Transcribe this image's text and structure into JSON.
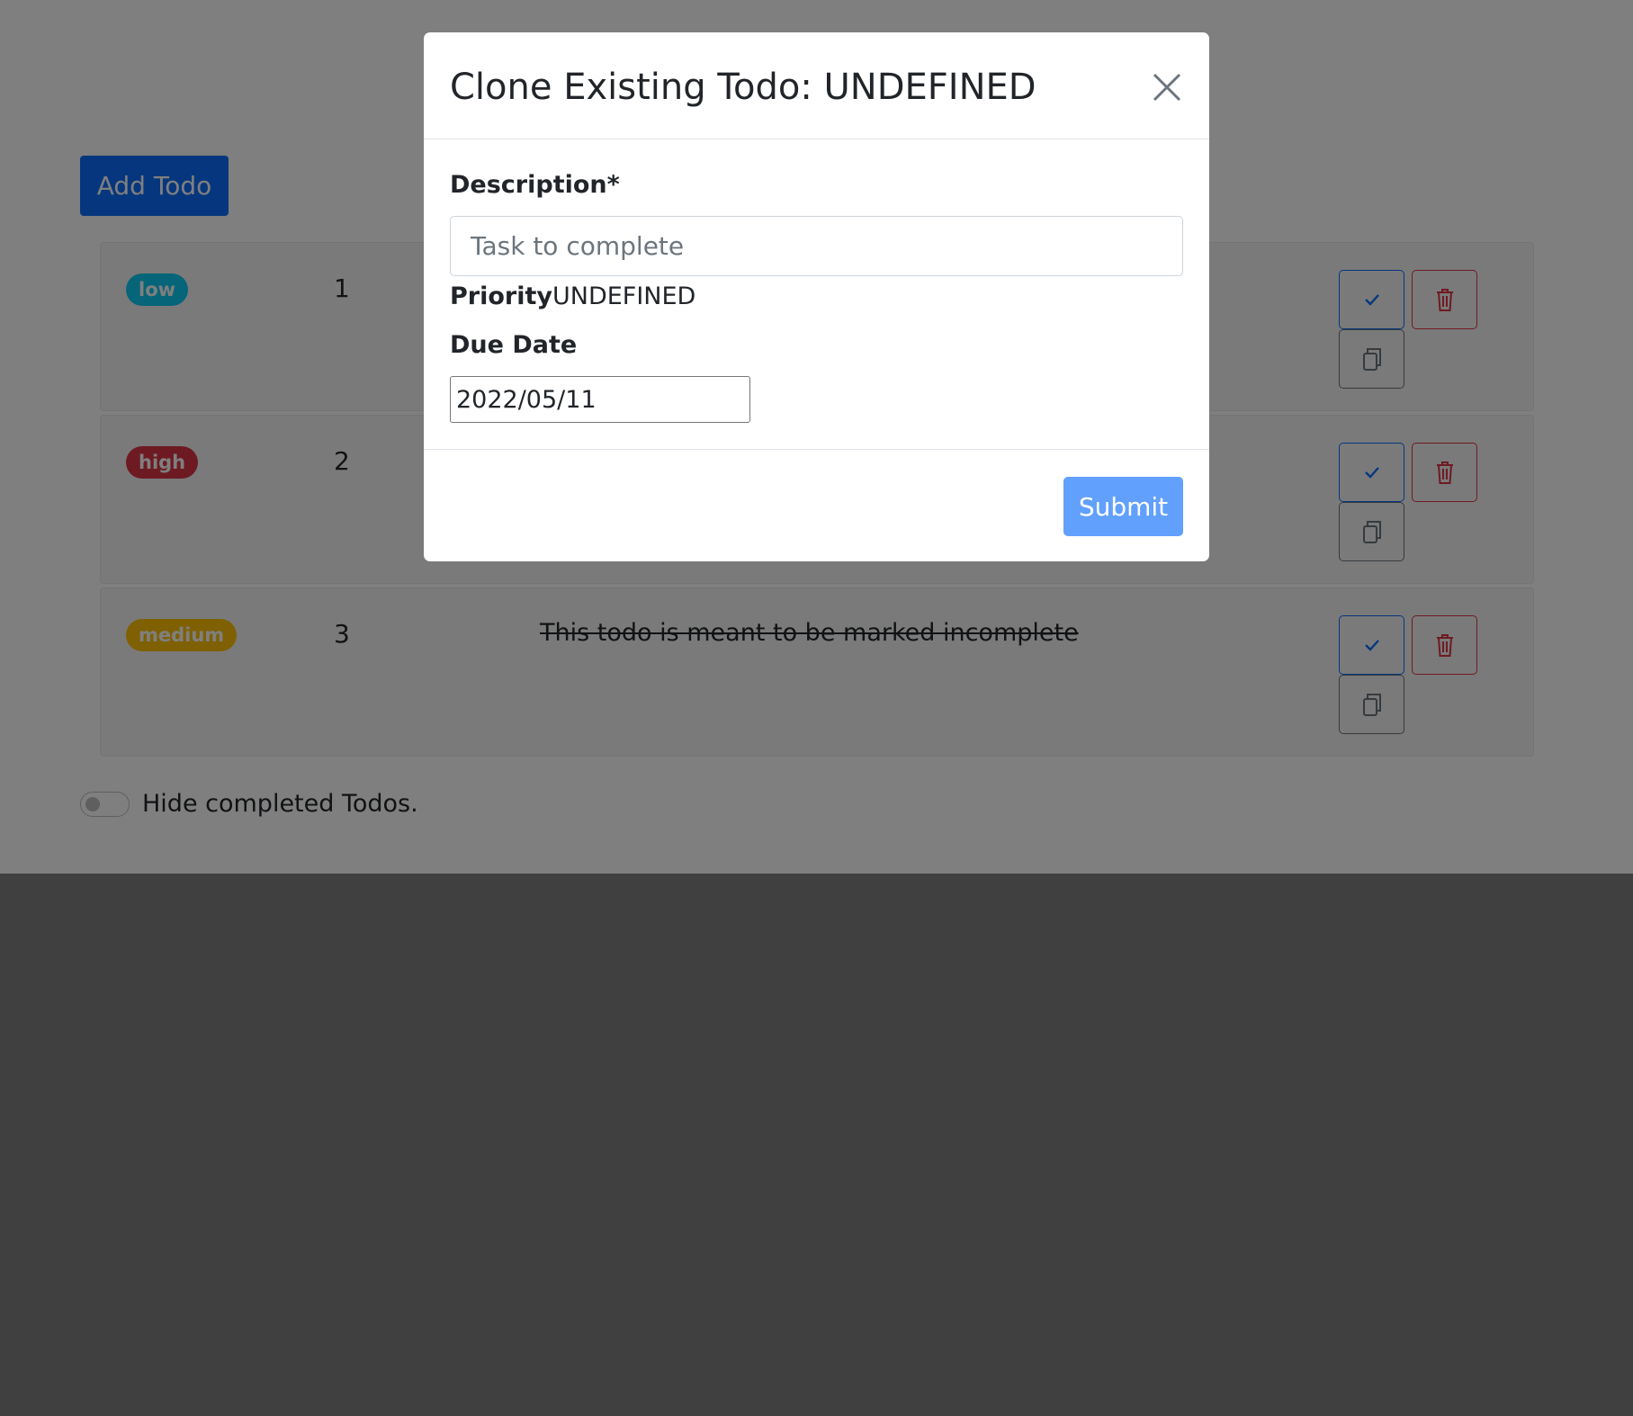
{
  "toolbar": {
    "add_label": "Add Todo"
  },
  "todos": [
    {
      "priority": "low",
      "number": "1",
      "description": "",
      "badge_color": "#0dcaf0",
      "completed": true
    },
    {
      "priority": "high",
      "number": "2",
      "description": "",
      "badge_color": "#dc3545",
      "completed": true
    },
    {
      "priority": "medium",
      "number": "3",
      "description": "This todo is meant to be marked incomplete",
      "badge_color": "#ffc107",
      "completed": true
    }
  ],
  "row_actions": {
    "check_icon": "check-icon",
    "delete_icon": "trash-icon",
    "clone_icon": "copy-icon"
  },
  "filter": {
    "label": "Hide completed Todos.",
    "checked": false
  },
  "modal": {
    "title": "Clone Existing Todo: UNDEFINED",
    "description_label": "Description*",
    "description_placeholder": "Task to complete",
    "description_value": "",
    "priority_label": "Priority",
    "priority_value": "UNDEFINED",
    "due_date_label": "Due Date",
    "due_date_value": "2022/05/11",
    "submit_label": "Submit",
    "close_icon": "close-icon"
  },
  "colors": {
    "primary": "#0d6efd",
    "danger": "#dc3545",
    "secondary": "#6c757d",
    "info": "#0dcaf0",
    "warning": "#ffc107"
  }
}
